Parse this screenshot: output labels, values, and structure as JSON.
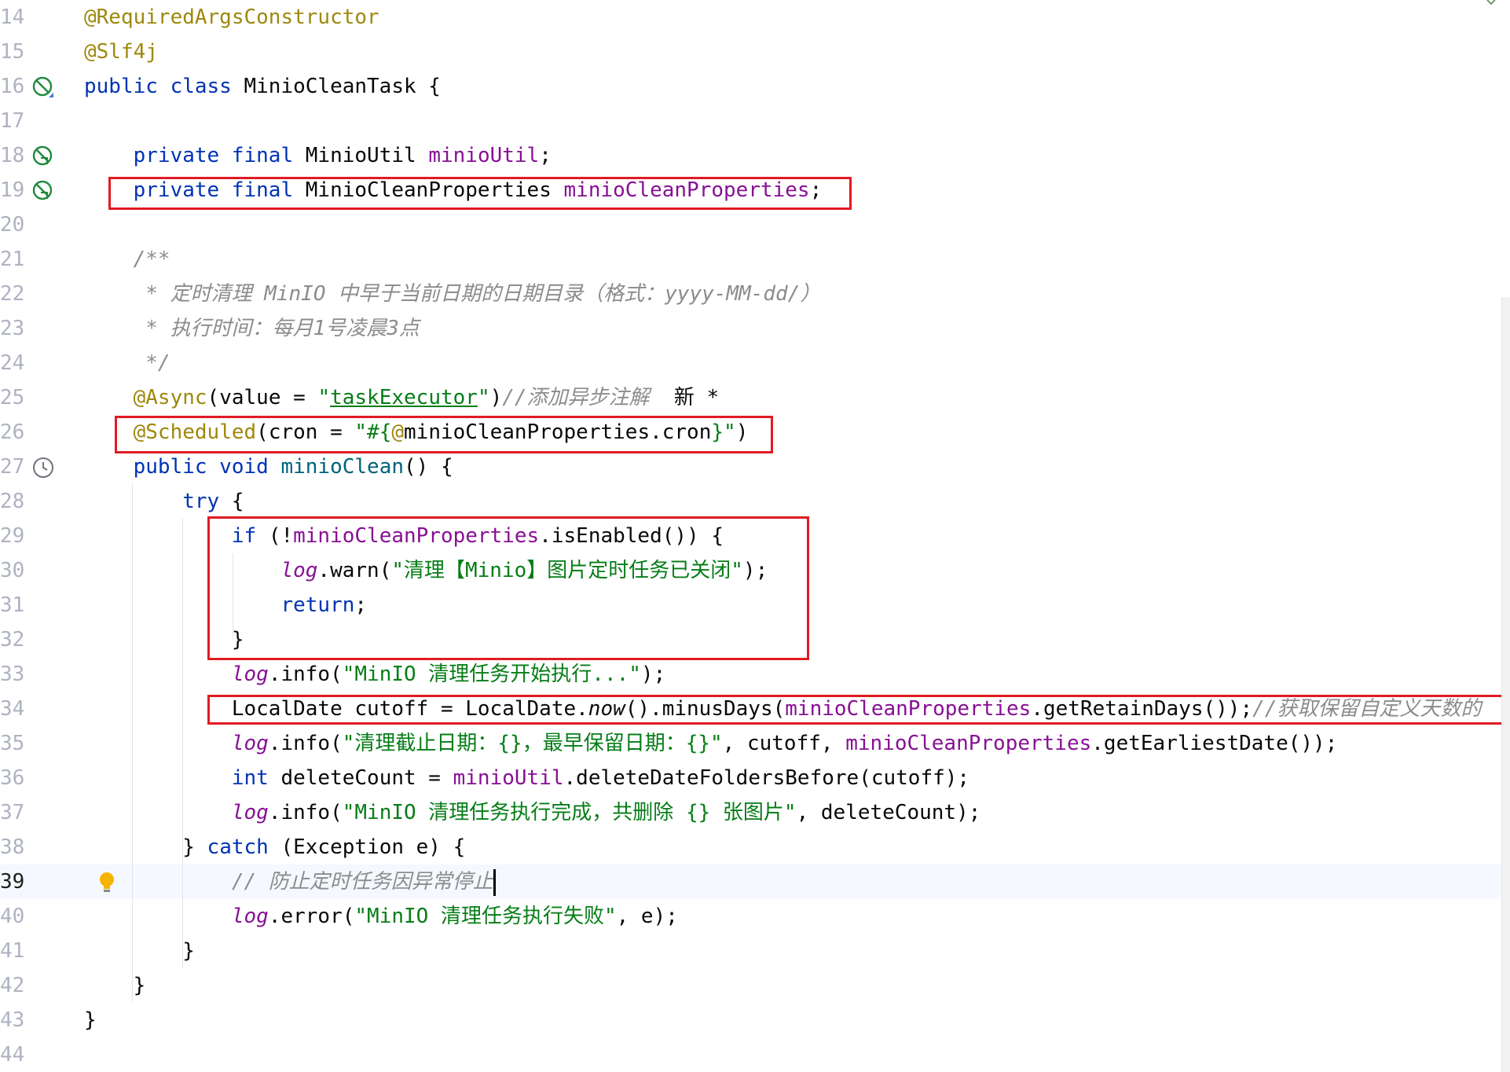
{
  "editor": {
    "lines": [
      {
        "num": "14",
        "tokens": [
          {
            "c": "ann",
            "t": "@RequiredArgsConstructor"
          }
        ]
      },
      {
        "num": "15",
        "tokens": [
          {
            "c": "ann",
            "t": "@Slf4j"
          }
        ]
      },
      {
        "num": "16",
        "icon": "no-implementation-icon",
        "tokens": [
          {
            "c": "kw",
            "t": "public class "
          },
          {
            "c": "",
            "t": "MinioCleanTask {"
          }
        ]
      },
      {
        "num": "17",
        "tokens": []
      },
      {
        "num": "18",
        "icon": "bean-injection-icon",
        "tokens": [
          {
            "c": "",
            "t": "    "
          },
          {
            "c": "kw",
            "t": "private final "
          },
          {
            "c": "",
            "t": "MinioUtil "
          },
          {
            "c": "fld",
            "t": "minioUtil"
          },
          {
            "c": "",
            "t": ";"
          }
        ]
      },
      {
        "num": "19",
        "icon": "bean-injection-icon",
        "tokens": [
          {
            "c": "",
            "t": "    "
          },
          {
            "c": "kw",
            "t": "private final "
          },
          {
            "c": "",
            "t": "MinioCleanProperties "
          },
          {
            "c": "fld",
            "t": "minioCleanProperties"
          },
          {
            "c": "",
            "t": ";"
          }
        ]
      },
      {
        "num": "20",
        "tokens": []
      },
      {
        "num": "21",
        "tokens": [
          {
            "c": "cmt",
            "t": "    /**"
          }
        ]
      },
      {
        "num": "22",
        "tokens": [
          {
            "c": "cmt",
            "t": "     * 定时清理 MinIO 中早于当前日期的日期目录（格式：yyyy-MM-dd/）"
          }
        ]
      },
      {
        "num": "23",
        "tokens": [
          {
            "c": "cmt",
            "t": "     * 执行时间：每月1号凌晨3点"
          }
        ]
      },
      {
        "num": "24",
        "tokens": [
          {
            "c": "cmt",
            "t": "     */"
          }
        ]
      },
      {
        "num": "25",
        "tokens": [
          {
            "c": "",
            "t": "    "
          },
          {
            "c": "ann",
            "t": "@Async"
          },
          {
            "c": "",
            "t": "(value = "
          },
          {
            "c": "str",
            "t": "\""
          },
          {
            "c": "str ul",
            "t": "taskExecutor"
          },
          {
            "c": "str",
            "t": "\""
          },
          {
            "c": "",
            "t": ")"
          },
          {
            "c": "cmt",
            "t": "//添加异步注解"
          },
          {
            "c": "",
            "t": "  新 *"
          }
        ]
      },
      {
        "num": "26",
        "tokens": [
          {
            "c": "",
            "t": "    "
          },
          {
            "c": "ann",
            "t": "@Scheduled"
          },
          {
            "c": "",
            "t": "(cron = "
          },
          {
            "c": "str",
            "t": "\"#{"
          },
          {
            "c": "ann",
            "t": "@"
          },
          {
            "c": "",
            "t": "minioCleanProperties.cron"
          },
          {
            "c": "str",
            "t": "}\""
          },
          {
            "c": "",
            "t": ")"
          }
        ]
      },
      {
        "num": "27",
        "icon": "scheduled-clock-icon",
        "tokens": [
          {
            "c": "",
            "t": "    "
          },
          {
            "c": "kw",
            "t": "public void "
          },
          {
            "c": "mth",
            "t": "minioClean"
          },
          {
            "c": "",
            "t": "() {"
          }
        ]
      },
      {
        "num": "28",
        "tokens": [
          {
            "c": "",
            "t": "        "
          },
          {
            "c": "kw",
            "t": "try "
          },
          {
            "c": "",
            "t": "{"
          }
        ]
      },
      {
        "num": "29",
        "tokens": [
          {
            "c": "",
            "t": "            "
          },
          {
            "c": "kw",
            "t": "if "
          },
          {
            "c": "",
            "t": "(!"
          },
          {
            "c": "fld",
            "t": "minioCleanProperties"
          },
          {
            "c": "",
            "t": ".isEnabled()) {"
          }
        ]
      },
      {
        "num": "30",
        "tokens": [
          {
            "c": "",
            "t": "                "
          },
          {
            "c": "fld it",
            "t": "log"
          },
          {
            "c": "",
            "t": ".warn("
          },
          {
            "c": "str",
            "t": "\"清理【Minio】图片定时任务已关闭\""
          },
          {
            "c": "",
            "t": ");"
          }
        ]
      },
      {
        "num": "31",
        "tokens": [
          {
            "c": "",
            "t": "                "
          },
          {
            "c": "kw",
            "t": "return"
          },
          {
            "c": "",
            "t": ";"
          }
        ]
      },
      {
        "num": "32",
        "tokens": [
          {
            "c": "",
            "t": "            }"
          }
        ]
      },
      {
        "num": "33",
        "tokens": [
          {
            "c": "",
            "t": "            "
          },
          {
            "c": "fld it",
            "t": "log"
          },
          {
            "c": "",
            "t": ".info("
          },
          {
            "c": "str",
            "t": "\"MinIO 清理任务开始执行...\""
          },
          {
            "c": "",
            "t": ");"
          }
        ]
      },
      {
        "num": "34",
        "tokens": [
          {
            "c": "",
            "t": "            LocalDate cutoff = LocalDate."
          },
          {
            "c": "it",
            "t": "now"
          },
          {
            "c": "",
            "t": "().minusDays("
          },
          {
            "c": "fld",
            "t": "minioCleanProperties"
          },
          {
            "c": "",
            "t": ".getRetainDays());"
          },
          {
            "c": "cmt",
            "t": "//获取保留自定义天数的"
          }
        ]
      },
      {
        "num": "35",
        "tokens": [
          {
            "c": "",
            "t": "            "
          },
          {
            "c": "fld it",
            "t": "log"
          },
          {
            "c": "",
            "t": ".info("
          },
          {
            "c": "str",
            "t": "\"清理截止日期：{}，最早保留日期：{}\""
          },
          {
            "c": "",
            "t": ", cutoff, "
          },
          {
            "c": "fld",
            "t": "minioCleanProperties"
          },
          {
            "c": "",
            "t": ".getEarliestDate());"
          }
        ]
      },
      {
        "num": "36",
        "tokens": [
          {
            "c": "",
            "t": "            "
          },
          {
            "c": "kw",
            "t": "int "
          },
          {
            "c": "",
            "t": "deleteCount = "
          },
          {
            "c": "fld",
            "t": "minioUtil"
          },
          {
            "c": "",
            "t": ".deleteDateFoldersBefore(cutoff);"
          }
        ]
      },
      {
        "num": "37",
        "tokens": [
          {
            "c": "",
            "t": "            "
          },
          {
            "c": "fld it",
            "t": "log"
          },
          {
            "c": "",
            "t": ".info("
          },
          {
            "c": "str",
            "t": "\"MinIO 清理任务执行完成，共删除 {} 张图片\""
          },
          {
            "c": "",
            "t": ", deleteCount);"
          }
        ]
      },
      {
        "num": "38",
        "tokens": [
          {
            "c": "",
            "t": "        } "
          },
          {
            "c": "kw",
            "t": "catch "
          },
          {
            "c": "",
            "t": "(Exception e) {"
          }
        ]
      },
      {
        "num": "39",
        "current": true,
        "bulb": true,
        "tokens": [
          {
            "c": "cmt",
            "t": "            // 防止定时任务因异常停止"
          }
        ]
      },
      {
        "num": "40",
        "tokens": [
          {
            "c": "",
            "t": "            "
          },
          {
            "c": "fld it",
            "t": "log"
          },
          {
            "c": "",
            "t": ".error("
          },
          {
            "c": "str",
            "t": "\"MinIO 清理任务执行失败\""
          },
          {
            "c": "",
            "t": ", e);"
          }
        ]
      },
      {
        "num": "41",
        "tokens": [
          {
            "c": "",
            "t": "        }"
          }
        ]
      },
      {
        "num": "42",
        "tokens": [
          {
            "c": "",
            "t": "    }"
          }
        ]
      },
      {
        "num": "43",
        "tokens": [
          {
            "c": "",
            "t": "}"
          }
        ]
      },
      {
        "num": "44",
        "tokens": []
      }
    ]
  },
  "colors": {
    "keyword": "#0033b3",
    "annotation": "#9e880d",
    "field": "#871094",
    "string": "#067d17",
    "comment": "#8c8c8c",
    "highlight_box": "#e01b24",
    "gutter_icon": "#208a3c"
  }
}
